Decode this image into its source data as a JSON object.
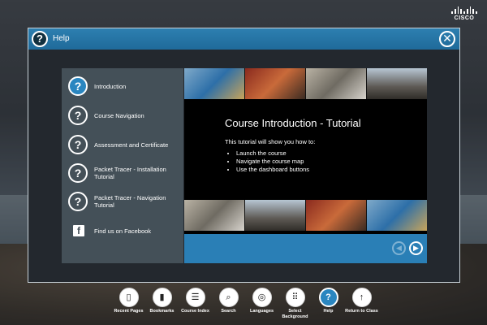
{
  "help_window": {
    "title": "Help",
    "menu": [
      {
        "label": "Introduction",
        "icon": "question-icon",
        "active": true
      },
      {
        "label": "Course Navigation",
        "icon": "question-icon"
      },
      {
        "label": "Assessment and Certificate",
        "icon": "question-icon"
      },
      {
        "label": "Packet Tracer - Installation Tutorial",
        "icon": "question-icon"
      },
      {
        "label": "Packet Tracer - Navigation Tutorial",
        "icon": "question-icon"
      },
      {
        "label": "Find us on Facebook",
        "icon": "facebook-icon"
      }
    ],
    "content": {
      "title": "Course Introduction - Tutorial",
      "intro": "This tutorial will show you how to:",
      "bullets": [
        "Launch the course",
        "Navigate the course map",
        "Use the dashboard buttons"
      ]
    }
  },
  "brand": {
    "name": "CISCO"
  },
  "toolbar": [
    {
      "label": "Recent Pages",
      "icon": "recent-pages-icon"
    },
    {
      "label": "Bookmarks",
      "icon": "bookmark-icon"
    },
    {
      "label": "Course Index",
      "icon": "list-icon"
    },
    {
      "label": "Search",
      "icon": "search-icon"
    },
    {
      "label": "Languages",
      "icon": "globe-icon"
    },
    {
      "label": "Select Background",
      "icon": "grid-icon"
    },
    {
      "label": "Help",
      "icon": "help-icon",
      "active": true
    },
    {
      "label": "Return to Class",
      "icon": "up-arrow-icon"
    }
  ],
  "colors": {
    "accent": "#2a86c0",
    "menu_bg": "#445058",
    "header": "#1f6a9a"
  }
}
